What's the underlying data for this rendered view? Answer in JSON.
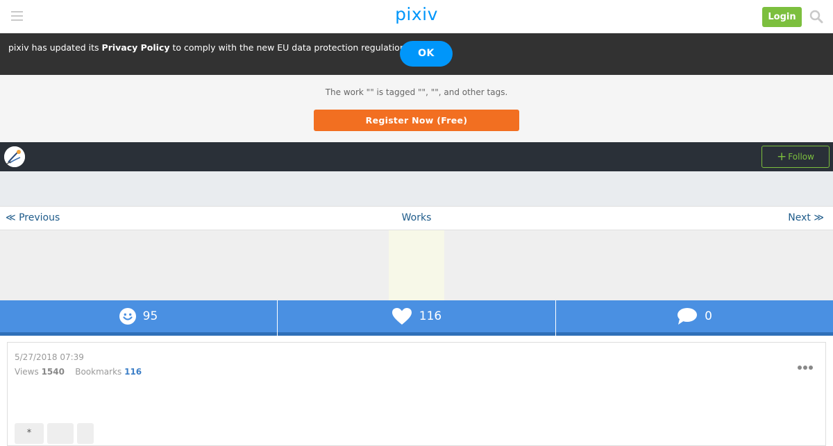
{
  "header": {
    "logo": "pixiv",
    "login_label": "Login",
    "menu_icon": "hamburger-icon",
    "search_icon": "search-icon"
  },
  "privacy_banner": {
    "text_before": "pixiv has updated its ",
    "link_text": "Privacy Policy",
    "text_after": " to comply with the new EU data protection regulation.",
    "ok_label": "OK"
  },
  "promo": {
    "text": "The work \"\" is tagged \"\", \"\", and other tags.",
    "register_label": "Register Now (Free)"
  },
  "user_bar": {
    "follow_label": "Follow"
  },
  "navigation": {
    "prev_label": "≪ Previous",
    "works_label": "Works",
    "next_label": "Next ≫"
  },
  "stats": {
    "likes": "95",
    "bookmarks": "116",
    "comments": "0"
  },
  "details": {
    "date": "5/27/2018 07:39",
    "views_label": "Views",
    "views_value": "1540",
    "bookmarks_label": "Bookmarks",
    "bookmarks_value": "116"
  },
  "tags": [
    "*",
    "",
    ""
  ],
  "colors": {
    "brand": "#0096fa",
    "login_green": "#7cbf3e",
    "register_orange": "#f26f21",
    "stats_blue": "#4a90e2",
    "banner_dark": "#323232",
    "userbar_dark": "#2a3038"
  }
}
